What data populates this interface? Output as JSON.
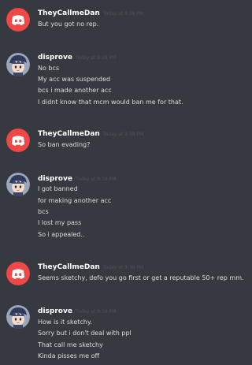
{
  "messages": [
    {
      "author": "TheyCallmeDan",
      "avatar_icon": "discord-logo-icon",
      "timestamp": "Today at 9:38 PM",
      "lines": [
        "But you got no rep."
      ]
    },
    {
      "author": "disprove",
      "avatar_icon": "anime-character-avatar-icon",
      "timestamp": "Today at 9:38 PM",
      "lines": [
        "No bcs",
        "My acc was suspended",
        "bcs i made another acc",
        "I didnt know that mcm would ban me for that."
      ]
    },
    {
      "author": "TheyCallmeDan",
      "avatar_icon": "discord-logo-icon",
      "timestamp": "Today at 9:39 PM",
      "lines": [
        "So ban evading?"
      ]
    },
    {
      "author": "disprove",
      "avatar_icon": "anime-character-avatar-icon",
      "timestamp": "Today at 9:39 PM",
      "lines": [
        "I got banned",
        "for making another acc",
        "bcs",
        "I lost my pass",
        "So i appealed.."
      ]
    },
    {
      "author": "TheyCallmeDan",
      "avatar_icon": "discord-logo-icon",
      "timestamp": "Today at 9:39 PM",
      "lines": [
        "Seems sketchy, defo you go first or get a reputable 50+ rep mm."
      ]
    },
    {
      "author": "disprove",
      "avatar_icon": "anime-character-avatar-icon",
      "timestamp": "Today at 9:39 PM",
      "lines": [
        "How is it sketchy.",
        "Sorry but i don't deal with ppl",
        "That call me sketchy",
        "Kinda pisses me off"
      ]
    }
  ],
  "colors": {
    "background": "#36393f",
    "discord_avatar": "#f04747",
    "username": "#ffffff",
    "timestamp": "#4f5359",
    "message_text": "#dcddde"
  }
}
